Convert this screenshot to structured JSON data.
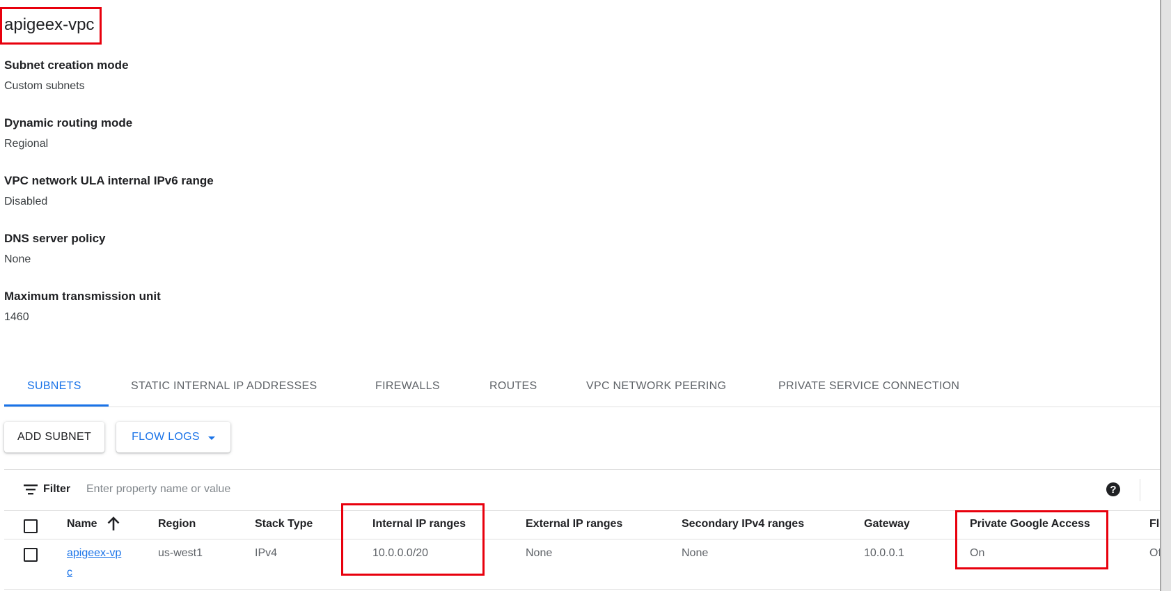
{
  "network": {
    "name": "apigeex-vpc"
  },
  "properties": [
    {
      "label": "Subnet creation mode",
      "value": "Custom subnets"
    },
    {
      "label": "Dynamic routing mode",
      "value": "Regional"
    },
    {
      "label": "VPC network ULA internal IPv6 range",
      "value": "Disabled"
    },
    {
      "label": "DNS server policy",
      "value": "None"
    },
    {
      "label": "Maximum transmission unit",
      "value": "1460"
    }
  ],
  "tabs": [
    {
      "label": "SUBNETS",
      "active": true
    },
    {
      "label": "STATIC INTERNAL IP ADDRESSES"
    },
    {
      "label": "FIREWALLS"
    },
    {
      "label": "ROUTES"
    },
    {
      "label": "VPC NETWORK PEERING"
    },
    {
      "label": "PRIVATE SERVICE CONNECTION"
    }
  ],
  "actions": {
    "add_subnet": "ADD SUBNET",
    "flow_logs": "FLOW LOGS"
  },
  "filter": {
    "label": "Filter",
    "placeholder": "Enter property name or value",
    "help_icon": "?"
  },
  "table": {
    "columns": [
      "Name",
      "Region",
      "Stack Type",
      "Internal IP ranges",
      "External IP ranges",
      "Secondary IPv4 ranges",
      "Gateway",
      "Private Google Access",
      "Flo"
    ],
    "rows": [
      {
        "name": "apigeex-vpc",
        "region": "us-west1",
        "stack_type": "IPv4",
        "internal_ip_ranges": "10.0.0.0/20",
        "external_ip_ranges": "None",
        "secondary_ipv4_ranges": "None",
        "gateway": "10.0.0.1",
        "private_google_access": "On",
        "flow_logs": "Off"
      }
    ]
  },
  "colors": {
    "accent": "#1a73e8",
    "highlight_box": "#e8000d",
    "text": "#202124",
    "muted_text": "#5f6368"
  },
  "icons": {
    "filter": "filter-lines-icon",
    "sort": "arrow-up-icon",
    "help": "help-circle-icon",
    "dropdown": "caret-down-icon"
  }
}
